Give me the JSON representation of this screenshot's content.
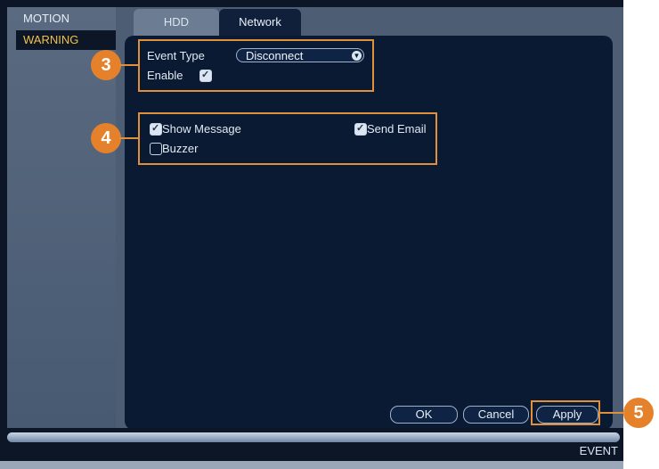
{
  "sidebar": {
    "items": [
      {
        "label": "MOTION"
      },
      {
        "label": "WARNING"
      }
    ]
  },
  "tabs": [
    {
      "label": "HDD"
    },
    {
      "label": "Network"
    }
  ],
  "event_type": {
    "label": "Event Type",
    "value": "Disconnect"
  },
  "enable": {
    "label": "Enable",
    "checked": true
  },
  "options": {
    "show_message": {
      "label": "Show Message",
      "checked": true
    },
    "send_email": {
      "label": "Send Email",
      "checked": true
    },
    "buzzer": {
      "label": "Buzzer",
      "checked": false
    }
  },
  "buttons": {
    "ok": "OK",
    "cancel": "Cancel",
    "apply": "Apply"
  },
  "markers": [
    "3",
    "4",
    "5"
  ],
  "footer": {
    "label": "EVENT"
  },
  "colors": {
    "accent": "#e5812a",
    "panel": "#0a1a33",
    "highlight": "#f2c24a"
  }
}
